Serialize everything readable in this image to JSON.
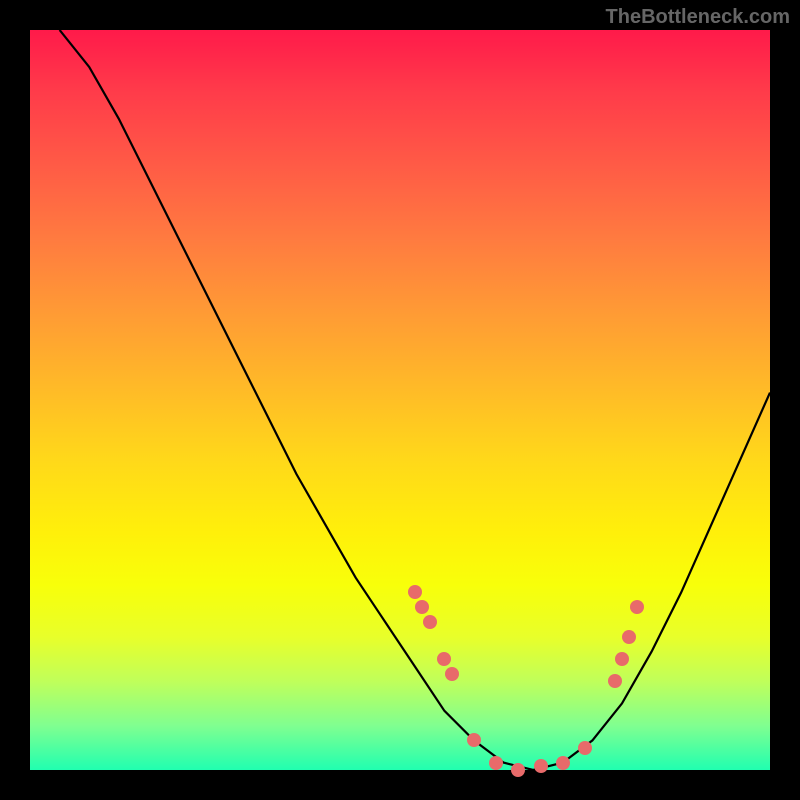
{
  "watermark": "TheBottleneck.com",
  "chart_data": {
    "type": "line",
    "title": "",
    "xlabel": "",
    "ylabel": "",
    "xlim": [
      0,
      100
    ],
    "ylim": [
      0,
      100
    ],
    "series": [
      {
        "name": "bottleneck-curve",
        "x": [
          4,
          8,
          12,
          16,
          20,
          24,
          28,
          32,
          36,
          40,
          44,
          48,
          52,
          56,
          60,
          64,
          68,
          72,
          76,
          80,
          84,
          88,
          92,
          96,
          100
        ],
        "values": [
          100,
          95,
          88,
          80,
          72,
          64,
          56,
          48,
          40,
          33,
          26,
          20,
          14,
          8,
          4,
          1,
          0,
          1,
          4,
          9,
          16,
          24,
          33,
          42,
          51
        ]
      }
    ],
    "highlight_points": {
      "name": "sample-dots",
      "x": [
        52,
        53,
        54,
        56,
        57,
        60,
        63,
        66,
        69,
        72,
        75,
        79,
        80,
        81,
        82
      ],
      "y": [
        24,
        22,
        20,
        15,
        13,
        4,
        1,
        0,
        0.5,
        1,
        3,
        12,
        15,
        18,
        22
      ]
    },
    "gradient_colors": {
      "top": "#ff1a4a",
      "mid": "#fff00a",
      "bottom": "#20ffb0"
    }
  }
}
